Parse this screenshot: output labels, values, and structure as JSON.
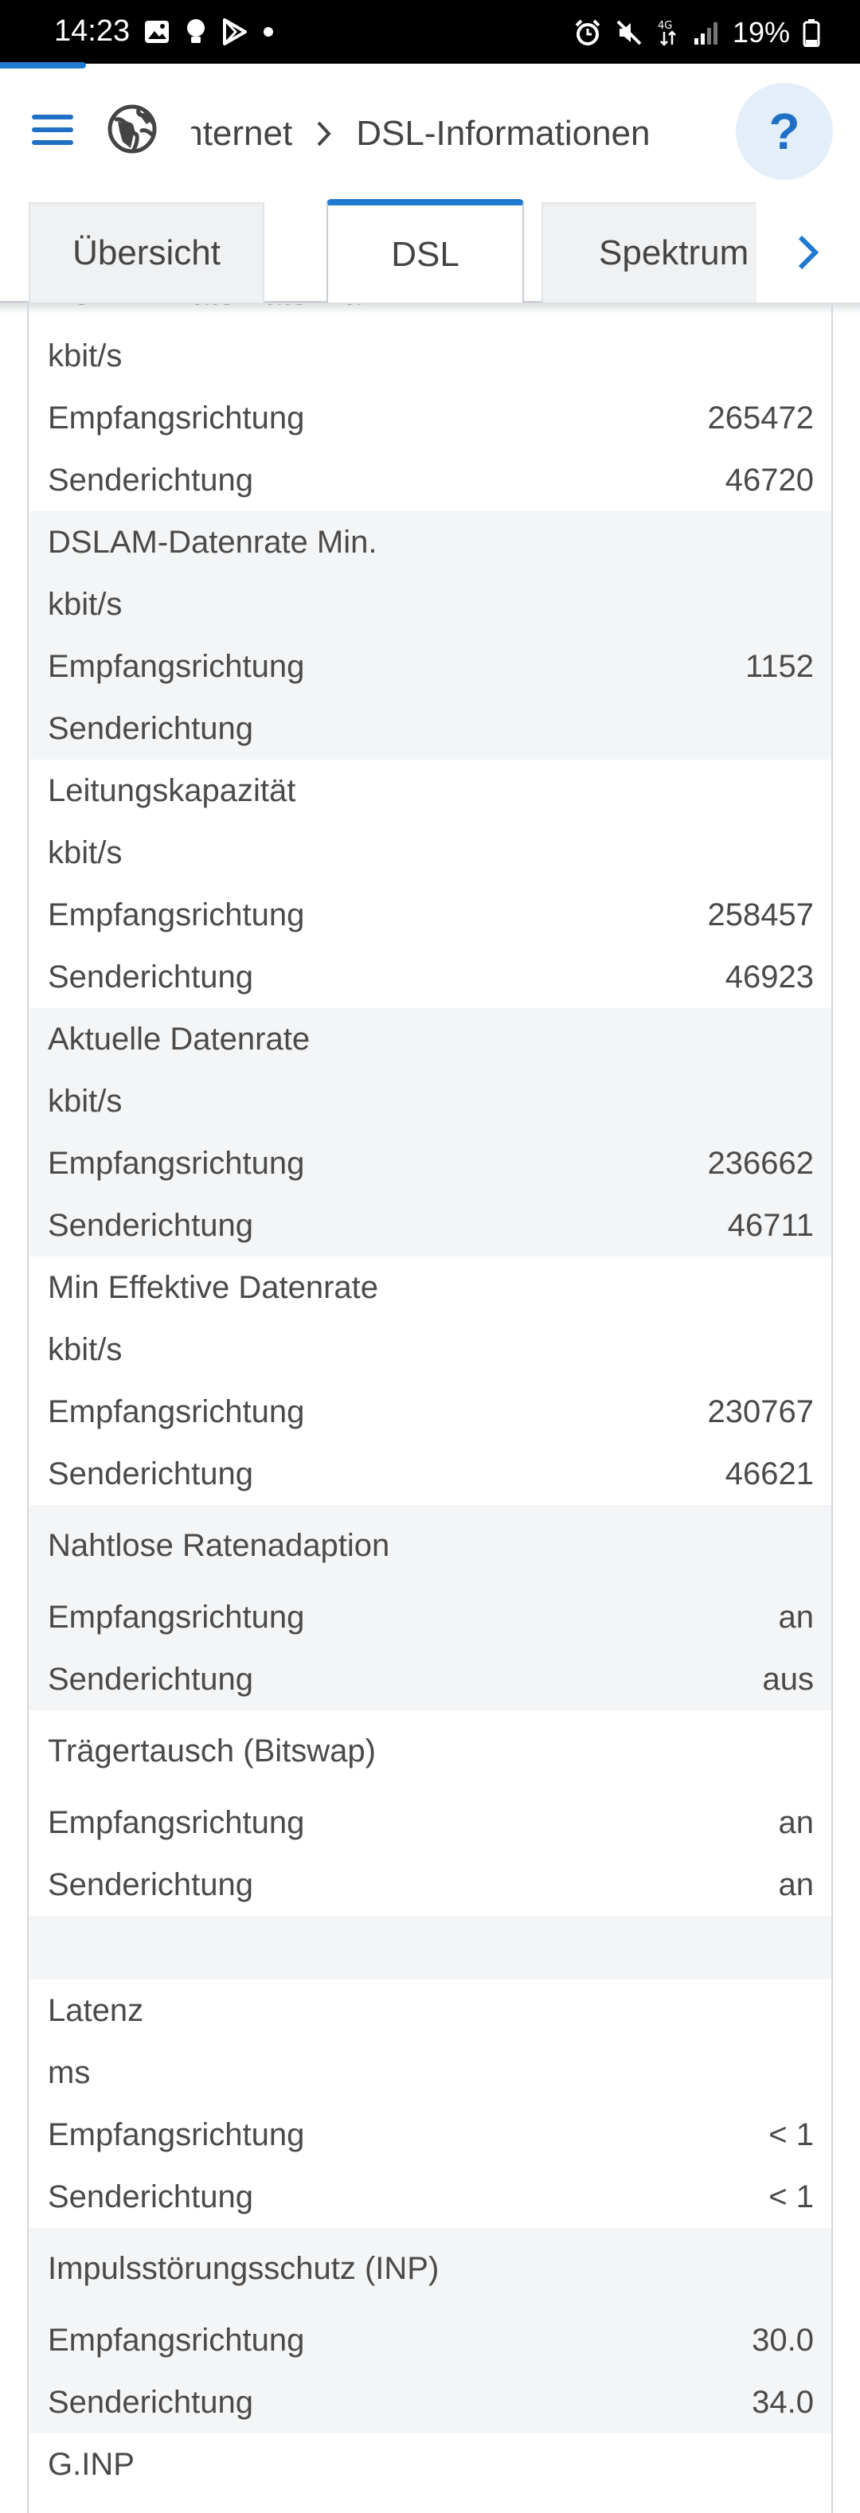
{
  "status_bar": {
    "time": "14:23",
    "network": "4G",
    "battery": "19%"
  },
  "header": {
    "breadcrumb_parent": "Internet",
    "breadcrumb_current": "DSL-Informationen",
    "help_label": "?"
  },
  "tabs": [
    {
      "label": "Übersicht"
    },
    {
      "label": "DSL"
    },
    {
      "label": "Spektrum"
    }
  ],
  "sections": {
    "dslam_max": {
      "title": "DSLAM-Datenrate Max.",
      "unit": "kbit/s",
      "rows": [
        {
          "label": "Empfangsrichtung",
          "value": "265472"
        },
        {
          "label": "Senderichtung",
          "value": "46720"
        }
      ]
    },
    "dslam_min": {
      "title": "DSLAM-Datenrate Min.",
      "unit": "kbit/s",
      "rows": [
        {
          "label": "Empfangsrichtung",
          "value": "1152"
        },
        {
          "label": "Senderichtung",
          "value": ""
        }
      ]
    },
    "capacity": {
      "title": "Leitungskapazität",
      "unit": "kbit/s",
      "rows": [
        {
          "label": "Empfangsrichtung",
          "value": "258457"
        },
        {
          "label": "Senderichtung",
          "value": "46923"
        }
      ]
    },
    "current_rate": {
      "title": "Aktuelle Datenrate",
      "unit": "kbit/s",
      "rows": [
        {
          "label": "Empfangsrichtung",
          "value": "236662"
        },
        {
          "label": "Senderichtung",
          "value": "46711"
        }
      ]
    },
    "min_effective": {
      "title": "Min Effektive Datenrate",
      "unit": "kbit/s",
      "rows": [
        {
          "label": "Empfangsrichtung",
          "value": "230767"
        },
        {
          "label": "Senderichtung",
          "value": "46621"
        }
      ]
    },
    "seamless": {
      "title": "Nahtlose Ratenadaption",
      "rows": [
        {
          "label": "Empfangsrichtung",
          "value": "an"
        },
        {
          "label": "Senderichtung",
          "value": "aus"
        }
      ]
    },
    "bitswap": {
      "title": "Trägertausch (Bitswap)",
      "rows": [
        {
          "label": "Empfangsrichtung",
          "value": "an"
        },
        {
          "label": "Senderichtung",
          "value": "an"
        }
      ]
    },
    "latency": {
      "title": "Latenz",
      "unit": "ms",
      "rows": [
        {
          "label": "Empfangsrichtung",
          "value": "< 1"
        },
        {
          "label": "Senderichtung",
          "value": "< 1"
        }
      ]
    },
    "inp": {
      "title": "Impulsstörungsschutz (INP)",
      "rows": [
        {
          "label": "Empfangsrichtung",
          "value": "30.0"
        },
        {
          "label": "Senderichtung",
          "value": "34.0"
        }
      ]
    },
    "ginp": {
      "title": "G.INP"
    }
  },
  "colors": {
    "accent": "#1f7ad0",
    "alt_row": "#f4f5f6",
    "text": "#4a4a4a"
  }
}
